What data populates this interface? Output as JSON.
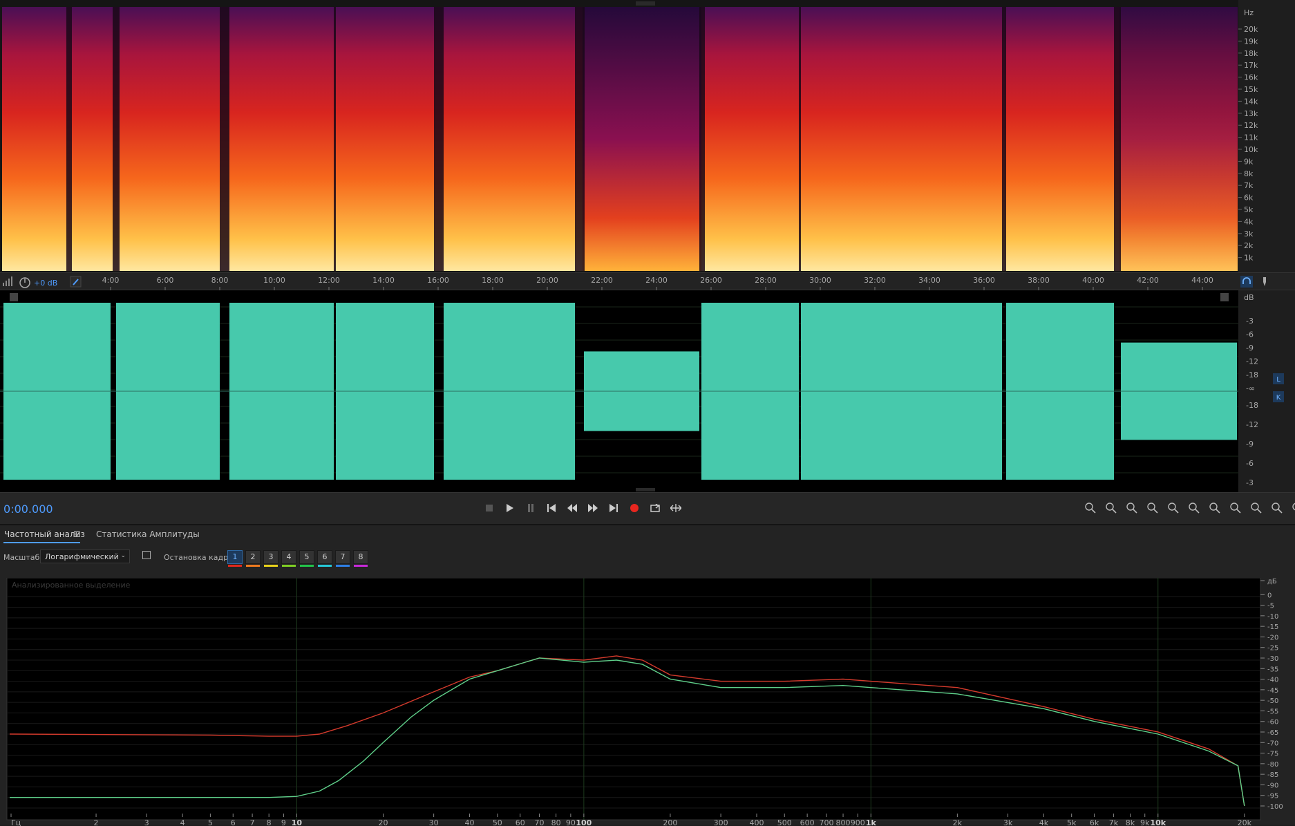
{
  "spectral": {
    "freq_unit": "Hz",
    "freq_labels": [
      "20k",
      "19k",
      "18k",
      "17k",
      "16k",
      "15k",
      "14k",
      "13k",
      "12k",
      "11k",
      "10k",
      "9k",
      "8k",
      "7k",
      "6k",
      "5k",
      "4k",
      "3k",
      "2k",
      "1k"
    ]
  },
  "timeline": {
    "gain": "+0 dB",
    "ticks": [
      "4:00",
      "6:00",
      "8:00",
      "10:00",
      "12:00",
      "14:00",
      "16:00",
      "18:00",
      "20:00",
      "22:00",
      "24:00",
      "26:00",
      "28:00",
      "30:00",
      "32:00",
      "34:00",
      "36:00",
      "38:00",
      "40:00",
      "42:00",
      "44:00"
    ]
  },
  "waveform": {
    "db_unit": "dB",
    "db_labels_top": [
      "-3",
      "-6",
      "-9",
      "-12",
      "-18",
      "-∞"
    ],
    "db_labels_bottom": [
      "-18",
      "-12",
      "-9",
      "-6",
      "-3"
    ],
    "channel_l": "L",
    "channel_r": "K"
  },
  "transport": {
    "time": "0:00.000",
    "buttons": [
      "stop-icon",
      "play-icon",
      "pause-icon",
      "skip-start-icon",
      "rewind-icon",
      "forward-icon",
      "skip-end-icon",
      "record-icon",
      "loop-icon",
      "skip-selection-icon"
    ],
    "zoom_buttons": [
      "zoom-in-amplitude-icon",
      "zoom-out-amplitude-icon",
      "zoom-in-time-icon",
      "zoom-out-time-icon",
      "zoom-full-icon",
      "zoom-in-point-icon",
      "zoom-in-left-icon",
      "zoom-in-right-icon",
      "zoom-selection-icon",
      "zoom-reset-icon",
      "zoom-tracks-icon"
    ]
  },
  "panel": {
    "tab_active": "Частотный анализ",
    "tab_other": "Статистика Амплитуды",
    "scale_label": "Масштаб:",
    "scale_value": "Логарифмический",
    "freeze_label": "Остановка кадра:",
    "frames": [
      "1",
      "2",
      "3",
      "4",
      "5",
      "6",
      "7",
      "8"
    ],
    "frame_colors": [
      "#e0281e",
      "#ee7a1f",
      "#e8d21b",
      "#7fcf24",
      "#22c44a",
      "#26c9d8",
      "#2e7fe6",
      "#c829d9"
    ],
    "graph_title": "Анализированное выделение"
  },
  "chart_data": {
    "type": "line",
    "xscale": "log",
    "xlabel": "Гц",
    "ylabel": "дБ",
    "xlim": [
      1,
      22000
    ],
    "ylim": [
      -100,
      5
    ],
    "x_ticks": [
      "Гц",
      "2",
      "3",
      "4",
      "5",
      "6",
      "7",
      "8",
      "9",
      "10",
      "20",
      "30",
      "40",
      "50",
      "60",
      "70",
      "80",
      "90",
      "100",
      "200",
      "300",
      "400",
      "500",
      "600",
      "700",
      "800",
      "900",
      "1k",
      "2k",
      "3k",
      "4k",
      "5k",
      "6k",
      "7k",
      "8k",
      "9k",
      "10k",
      "20k"
    ],
    "y_ticks": [
      "дБ",
      "0",
      "-5",
      "-10",
      "-15",
      "-20",
      "-25",
      "-30",
      "-35",
      "-40",
      "-45",
      "-50",
      "-55",
      "-60",
      "-65",
      "-70",
      "-75",
      "-80",
      "-85",
      "-90",
      "-95",
      "-100"
    ],
    "series": [
      {
        "color": "#d43a2c",
        "x": [
          1,
          5,
          8,
          10,
          12,
          15,
          20,
          30,
          40,
          50,
          70,
          100,
          130,
          160,
          200,
          300,
          500,
          800,
          1000,
          2000,
          4000,
          6000,
          10000,
          15000,
          19000,
          20000
        ],
        "y": [
          -65,
          -65.5,
          -66,
          -66,
          -65,
          -61,
          -55,
          -45,
          -38,
          -35,
          -29,
          -30,
          -28,
          -30,
          -37,
          -40,
          -40,
          -39,
          -40,
          -43,
          -52,
          -58,
          -64,
          -72,
          -80,
          -99
        ]
      },
      {
        "color": "#5fd08a",
        "x": [
          1,
          5,
          8,
          10,
          12,
          14,
          17,
          20,
          25,
          30,
          40,
          50,
          70,
          100,
          130,
          160,
          200,
          300,
          500,
          800,
          1000,
          2000,
          4000,
          6000,
          10000,
          15000,
          19000,
          20000
        ],
        "y": [
          -95,
          -95,
          -95,
          -94.5,
          -92,
          -87,
          -78,
          -69,
          -57,
          -49,
          -39,
          -35,
          -29,
          -31,
          -30,
          -32,
          -39,
          -43,
          -43,
          -42,
          -43,
          -46,
          -53,
          -59,
          -65,
          -73,
          -80,
          -99
        ]
      }
    ]
  }
}
